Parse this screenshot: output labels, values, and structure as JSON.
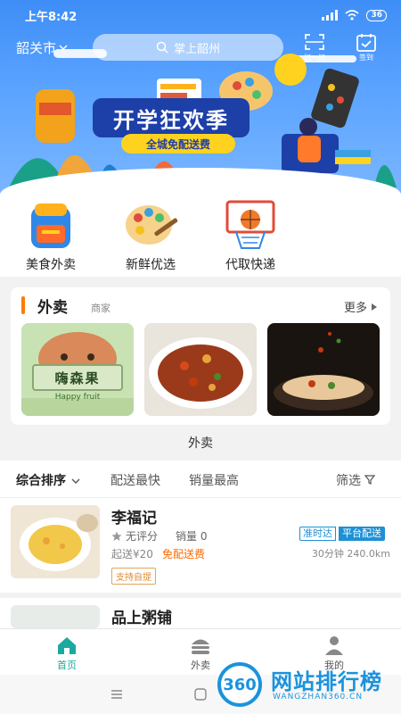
{
  "status_bar": {
    "time": "上午8:42",
    "battery": "36"
  },
  "header": {
    "city": "韶关市",
    "search_placeholder": "掌上韶州",
    "scan_label": "扫一扫",
    "checkin_label": "签到"
  },
  "banner": {
    "title": "开学狂欢季",
    "subtitle": "全城免配送费"
  },
  "quick_categories": [
    {
      "label": "美食外卖",
      "icon": "backpack-icon"
    },
    {
      "label": "新鲜优选",
      "icon": "palette-icon"
    },
    {
      "label": "代取快递",
      "icon": "basketball-hoop-icon"
    }
  ],
  "takeaway_card": {
    "title": "外卖",
    "subtitle": "商家",
    "more": "更多",
    "thumb_sign_cn": "嗨森果",
    "thumb_sign_en": "Happy fruit"
  },
  "section_label": "外卖",
  "sort_bar": {
    "options": [
      "综合排序",
      "配送最快",
      "销量最高"
    ],
    "filter": "筛选"
  },
  "stores": [
    {
      "name": "李福记",
      "rating": "无评分",
      "sales": "销量 0",
      "tag_ontime": "准时达",
      "tag_platform": "平台配送",
      "min_order": "起送¥20",
      "free_delivery": "免配送费",
      "time_distance": "30分钟 240.0km",
      "pickup": "支持自提"
    },
    {
      "name": "品上粥铺"
    }
  ],
  "tabs": [
    {
      "label": "首页",
      "active": true
    },
    {
      "label": "外卖",
      "active": false
    },
    {
      "label": "我的",
      "active": false
    }
  ],
  "watermark": {
    "badge": "360",
    "title": "网站排行榜",
    "url": "WANGZHAN360.CN"
  },
  "colors": {
    "accent": "#ff7a00",
    "brand_blue": "#1e90d6",
    "active_tab": "#19a9a0"
  }
}
